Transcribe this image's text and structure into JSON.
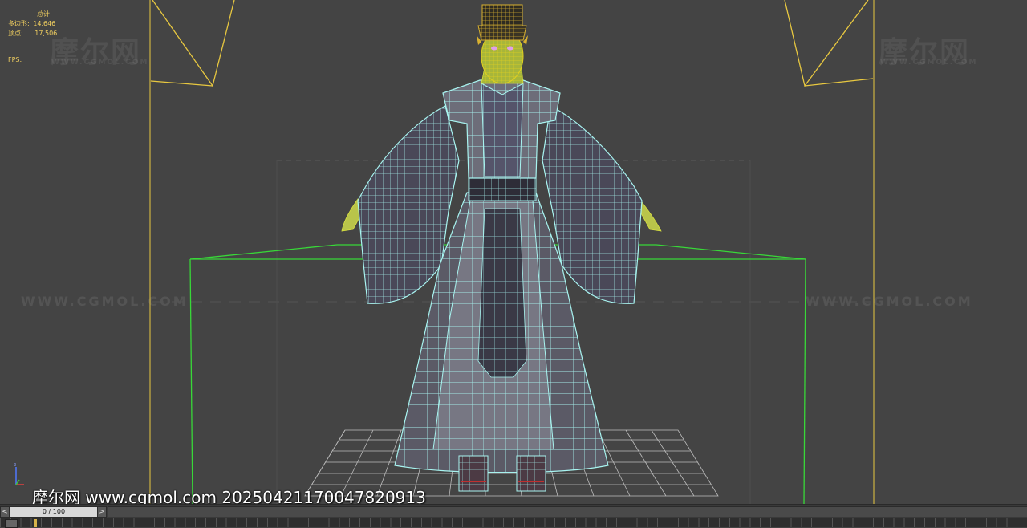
{
  "viewport": {
    "stats": {
      "title": "总计",
      "polygons_label": "多边形:",
      "polygons_value": "14,646",
      "vertices_label": "顶点:",
      "vertices_value": "17,506",
      "fps_label": "FPS:"
    },
    "watermarks": {
      "logo": "摩尔网",
      "small": "WWW.CGMOL.COM",
      "url": "WWW.CGMOL.COM"
    },
    "overlay_caption": "摩尔网 www.cgmol.com 20250421170047820913"
  },
  "timeline": {
    "prev_label": "<",
    "next_label": ">",
    "frame_display": "0 / 100"
  },
  "colors": {
    "background": "#444444",
    "safe_frame": "#e8c840",
    "bounding_box": "#38d838",
    "wireframe": "#9ff0f0",
    "stats_text": "#f2d060"
  }
}
